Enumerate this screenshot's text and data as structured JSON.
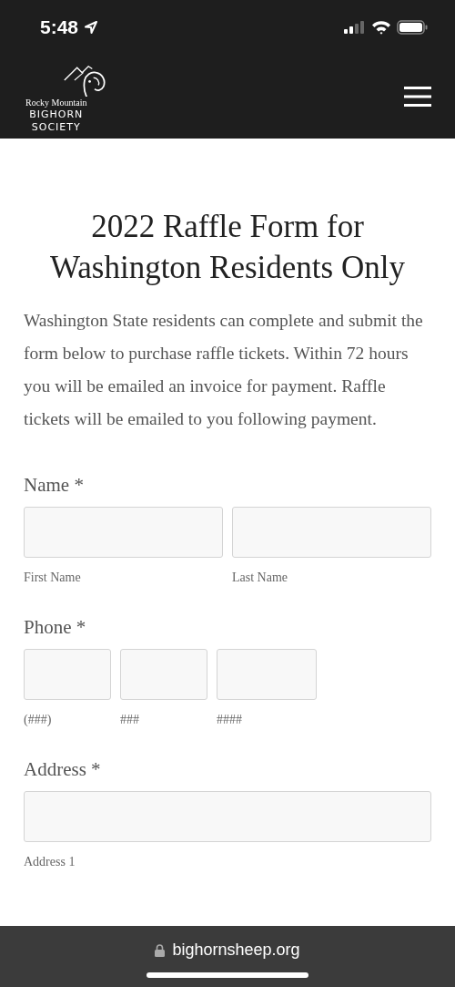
{
  "status_bar": {
    "time": "5:48"
  },
  "header": {
    "logo": {
      "line_1": "Rocky Mountain",
      "line_2": "BIGHORN",
      "line_3": "SOCIETY"
    }
  },
  "title": "2022 Raffle Form for Washington Residents Only",
  "intro": "Washington State residents can complete and submit the form below to purchase raffle tickets. Within 72 hours you will be emailed an invoice for payment. Raffle tickets will be emailed to you following payment.",
  "fields": [
    {
      "label": "Name *",
      "kind": "name",
      "inputs": [
        {
          "sublabel": "First Name"
        },
        {
          "sublabel": "Last Name"
        }
      ]
    },
    {
      "label": "Phone *",
      "kind": "phone",
      "inputs": [
        {
          "sublabel": "(###)"
        },
        {
          "sublabel": "###"
        },
        {
          "sublabel": "####"
        }
      ]
    },
    {
      "label": "Address *",
      "kind": "full",
      "inputs": [
        {
          "sublabel": "Address 1"
        }
      ]
    }
  ],
  "browser_bar": {
    "url": "bighornsheep.org"
  }
}
